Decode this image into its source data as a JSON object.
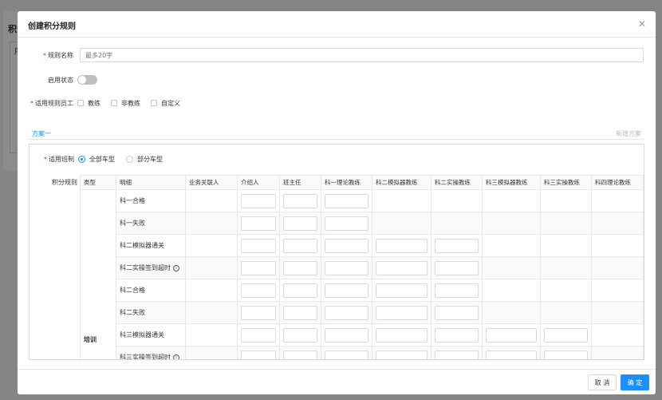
{
  "background": {
    "title": "积分",
    "sub": "序"
  },
  "modal": {
    "title": "创建积分规则",
    "close_icon": "close-icon"
  },
  "form": {
    "rule_name": {
      "label": "规则名称",
      "placeholder": "最多20字"
    },
    "status": {
      "label": "启用状态",
      "enabled": false
    },
    "staff": {
      "label": "适用规则员工",
      "options": [
        "教练",
        "非教练",
        "自定义"
      ]
    }
  },
  "plans": {
    "tab": "方案一",
    "add": "新增方案"
  },
  "plan": {
    "class_label": "适用班制",
    "class_options": [
      {
        "label": "全部车型",
        "checked": true
      },
      {
        "label": "部分车型",
        "checked": false
      }
    ],
    "rules_label": "积分规则",
    "columns": [
      "类型",
      "明细",
      "业务关联人",
      "介绍人",
      "班主任",
      "科一理论教练",
      "科二模拟器教练",
      "科二实操教练",
      "科三模拟器教练",
      "科三实操教练",
      "科四理论教练"
    ],
    "type_value": "培训",
    "rows": [
      {
        "detail": "科一合格",
        "inputs": [
          false,
          true,
          true,
          true,
          false,
          false,
          false,
          false,
          false
        ],
        "info": false
      },
      {
        "detail": "科一失败",
        "inputs": [
          false,
          true,
          true,
          true,
          false,
          false,
          false,
          false,
          false
        ],
        "info": false
      },
      {
        "detail": "科二模拟器通关",
        "inputs": [
          false,
          true,
          true,
          true,
          true,
          true,
          false,
          false,
          false
        ],
        "info": false
      },
      {
        "detail": "科二实操签到超时",
        "inputs": [
          false,
          true,
          true,
          true,
          true,
          true,
          false,
          false,
          false
        ],
        "info": true
      },
      {
        "detail": "科二合格",
        "inputs": [
          false,
          true,
          true,
          true,
          true,
          true,
          false,
          false,
          false
        ],
        "info": false
      },
      {
        "detail": "科二失败",
        "inputs": [
          false,
          true,
          true,
          true,
          true,
          true,
          false,
          false,
          false
        ],
        "info": false
      },
      {
        "detail": "科三模拟器通关",
        "inputs": [
          false,
          true,
          true,
          true,
          true,
          true,
          true,
          true,
          false
        ],
        "info": false
      },
      {
        "detail": "科三实操签到超时",
        "inputs": [
          false,
          true,
          true,
          true,
          true,
          true,
          true,
          true,
          false
        ],
        "info": true
      }
    ]
  },
  "footer": {
    "cancel": "取 消",
    "ok": "确 定"
  }
}
